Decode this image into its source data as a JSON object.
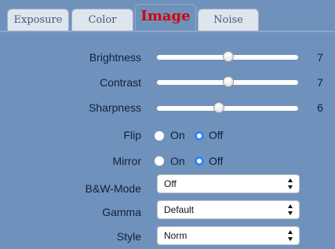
{
  "tabs": [
    {
      "label": "Exposure"
    },
    {
      "label": "Color"
    },
    {
      "label": "Image"
    },
    {
      "label": "Noise"
    }
  ],
  "active_tab": "Image",
  "brightness": {
    "label": "Brightness",
    "value": "7"
  },
  "contrast": {
    "label": "Contrast",
    "value": "7"
  },
  "sharpness": {
    "label": "Sharpness",
    "value": "6"
  },
  "flip": {
    "label": "Flip",
    "on_label": "On",
    "off_label": "Off",
    "selected": "Off"
  },
  "mirror": {
    "label": "Mirror",
    "on_label": "On",
    "off_label": "Off",
    "selected": "Off"
  },
  "bw_mode": {
    "label": "B&W-Mode",
    "selected": "Off"
  },
  "gamma": {
    "label": "Gamma",
    "selected": "Default"
  },
  "style": {
    "label": "Style",
    "selected": "Norm"
  },
  "colors": {
    "panel_bg": "#6f92bd",
    "active_tab_text": "#d50000",
    "tab_text": "#3f5b84",
    "radio_selected": "#2f86f6"
  }
}
